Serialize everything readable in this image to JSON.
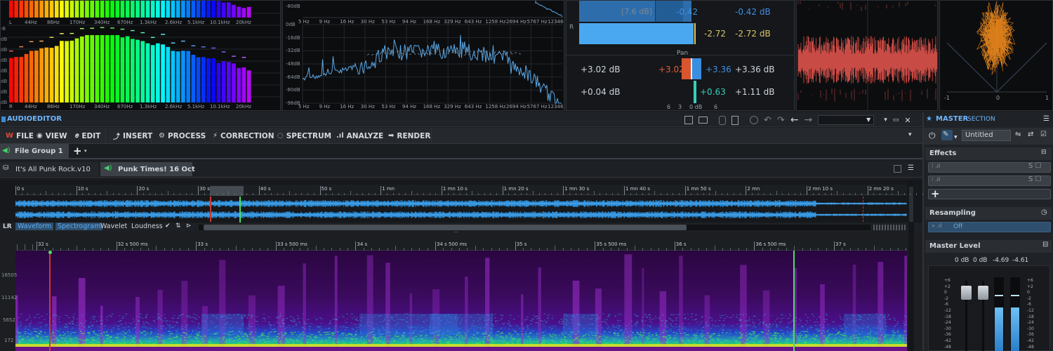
{
  "spectrum_top": {
    "freq_labels": [
      "L",
      "44Hz",
      "86Hz",
      "170Hz",
      "340Hz",
      "670Hz",
      "1.3kHz",
      "2.6kHz",
      "5.1kHz",
      "10.1kHz",
      "20kHz"
    ],
    "freq_labels_bottom": [
      "R",
      "44Hz",
      "86Hz",
      "170Hz",
      "340Hz",
      "670Hz",
      "1.3kHz",
      "2.6kHz",
      "5.1kHz",
      "10.1kHz",
      "20kHz"
    ],
    "db_labels": [
      "-B",
      "dB",
      "dB",
      "dB",
      "dB",
      "dB",
      "dB",
      "dB"
    ]
  },
  "fft": {
    "top_db": "-80dB",
    "freq_labels": [
      "5 Hz",
      "9 Hz",
      "16 Hz",
      "30 Hz",
      "53 Hz",
      "94 Hz",
      "168 Hz",
      "329 Hz",
      "643 Hz",
      "1258 Hz",
      "2694 Hz",
      "5767 Hz",
      "12346 Hz"
    ],
    "db_labels": [
      "0dB",
      "-16dB",
      "-32dB",
      "-48dB",
      "-64dB",
      "-80dB",
      "-96dB"
    ]
  },
  "meter": {
    "bracket_label": "[7.6 dB]",
    "l_val_a": "-0.42",
    "l_val_b": "-0.42 dB",
    "r_label": "R",
    "r_val_a": "-2.72",
    "r_val_b": "-2.72 dB",
    "pan_label": "Pan",
    "pan_left": "+3.02 dB",
    "pan_left_marker": "+3.02",
    "pan_right_marker": "+3.36",
    "pan_right": "+3.36 dB",
    "low_left": "+0.04 dB",
    "low_marker": "+0.63",
    "low_right": "+1.11 dB",
    "scale": [
      "6",
      "3",
      "0 dB",
      "6"
    ]
  },
  "audioeditor": {
    "title": "AUDIOEDITOR",
    "menu": [
      "FILE",
      "VIEW",
      "EDIT",
      "INSERT",
      "PROCESS",
      "CORRECTION",
      "SPECTRUM",
      "ANALYZE",
      "RENDER"
    ],
    "group_tab": "File Group 1",
    "file_tabs": [
      "It's All Punk Rock.v10",
      "Punk Times! 16 Oct"
    ],
    "overview_ruler": [
      "0 s",
      "10 s",
      "20 s",
      "30 s",
      "40 s",
      "50 s",
      "1 mn",
      "1 mn 10 s",
      "1 mn 20 s",
      "1 mn 30 s",
      "1 mn 40 s",
      "1 mn 50 s",
      "2 mn",
      "2 mn 10 s",
      "2 mn 20 s"
    ],
    "view_modes": [
      "LR",
      "Waveform",
      "Spectrogram",
      "Wavelet",
      "Loudness"
    ],
    "detail_ruler": [
      "32 s",
      "32 s 500 ms",
      "33 s",
      "33 s 500 ms",
      "34 s",
      "34 s 500 ms",
      "35 s",
      "35 s 500 ms",
      "36 s",
      "36 s 500 ms",
      "37 s"
    ],
    "spec_labels": [
      "16505",
      "11142",
      "5652",
      "172"
    ]
  },
  "master": {
    "title_a": "MASTER",
    "title_b": "SECTION",
    "preset": "Untitled",
    "effects_label": "Effects",
    "resampling_label": "Resampling",
    "resampling_value": "Off",
    "master_level_label": "Master Level",
    "levels": [
      "0 dB",
      "0 dB",
      "-4.69",
      "-4.61"
    ],
    "scale": [
      "+6",
      "+2",
      "0",
      "-2",
      "-6",
      "-12",
      "-18",
      "-24",
      "-30",
      "-36",
      "-42",
      "-48"
    ]
  }
}
